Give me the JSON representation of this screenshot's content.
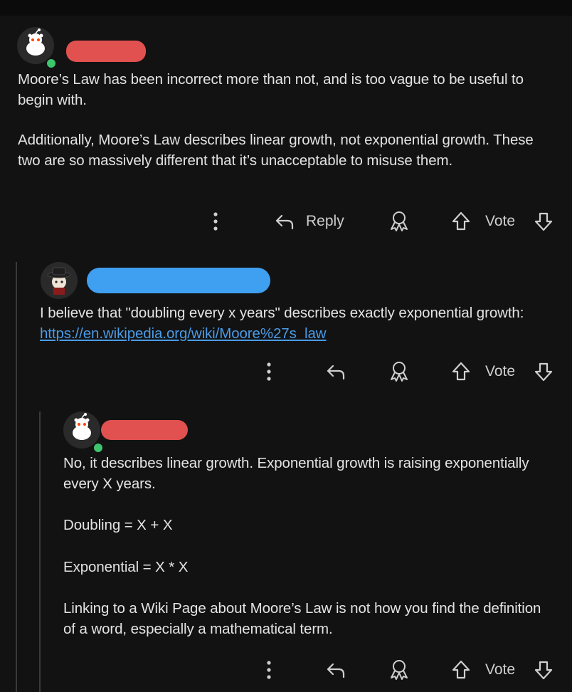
{
  "comments": [
    {
      "username_redaction_color": "#e0514f",
      "paragraphs": [
        "Moore’s Law has been incorrect more than not, and is too vague to be useful to begin with.",
        "Additionally, Moore’s Law describes linear growth, not exponential growth. These two are so massively different that it’s unacceptable to misuse them."
      ],
      "actions": {
        "reply_label": "Reply",
        "vote_label": "Vote"
      }
    },
    {
      "username_redaction_color": "#3f9ff0",
      "text_prefix": "I believe that \"doubling every x years\" describes exactly exponential growth: ",
      "link_text": "https://en.wikipedia.org/wiki/Moore%27s_law",
      "actions": {
        "vote_label": "Vote"
      }
    },
    {
      "username_redaction_color": "#e0514f",
      "paragraphs": [
        "No, it describes linear growth. Exponential growth is raising exponentially every X years.",
        "Doubling = X + X",
        "Exponential = X * X",
        "Linking to a Wiki Page about Moore’s Law is not how you find the definition of a word, especially a mathematical term."
      ],
      "actions": {
        "vote_label": "Vote"
      }
    }
  ],
  "icons": {
    "more": "more-vertical-icon",
    "reply": "reply-arrow-icon",
    "award": "award-icon",
    "upvote": "upvote-arrow-icon",
    "downvote": "downvote-arrow-icon"
  }
}
